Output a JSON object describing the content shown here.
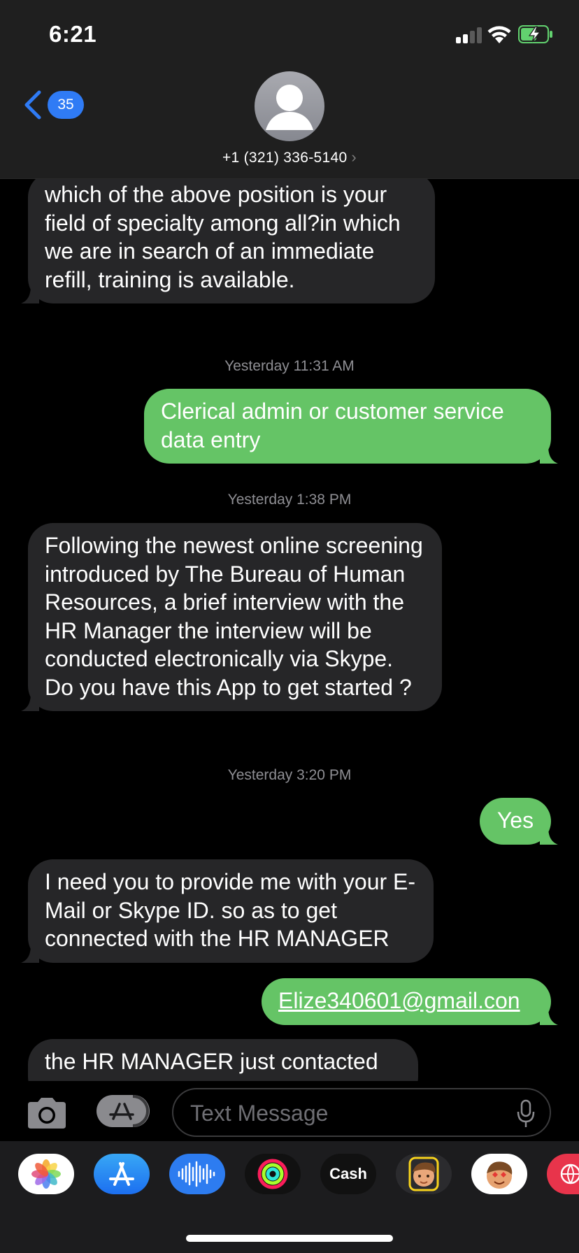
{
  "status_bar": {
    "time": "6:21"
  },
  "header": {
    "back_count": "35",
    "contact": "+1 (321) 336-5140",
    "chevron": "›"
  },
  "messages": [
    {
      "from": "them",
      "text": "which of the above position is your field of specialty among all?in which we are in search of an immediate refill, training is available."
    },
    {
      "timestamp": "Yesterday 11:31 AM"
    },
    {
      "from": "me",
      "text": "Clerical admin or customer service data entry"
    },
    {
      "timestamp": "Yesterday 1:38 PM"
    },
    {
      "from": "them",
      "text": "Following the newest online screening introduced by The Bureau of Human Resources, a brief interview with the HR Manager the interview will be conducted electronically via Skype. Do you have this App   to get started ?"
    },
    {
      "timestamp": "Yesterday 3:20 PM"
    },
    {
      "from": "me",
      "text": "Yes"
    },
    {
      "from": "them",
      "text": "I need you to provide me with your E-Mail or Skype ID. so as to get connected with the HR MANAGER"
    },
    {
      "from": "me",
      "text": "Elize340601@gmail.con",
      "link": true
    },
    {
      "from": "them",
      "text": "the HR MANAGER just contacted"
    }
  ],
  "compose": {
    "placeholder": "Text Message"
  },
  "drawer": {
    "apps": [
      {
        "name": "photos-app-icon"
      },
      {
        "name": "app-store-app-icon"
      },
      {
        "name": "audio-message-app-icon"
      },
      {
        "name": "fitness-app-icon"
      },
      {
        "name": "apple-cash-app-icon",
        "label": "Cash"
      },
      {
        "name": "memoji-app-icon"
      },
      {
        "name": "animoji-app-icon"
      },
      {
        "name": "web-images-app-icon"
      }
    ]
  },
  "colors": {
    "incoming_bubble": "#262628",
    "outgoing_bubble": "#65c466",
    "accent_blue": "#2f7bf5",
    "background": "#000000",
    "timestamp": "#8e8e93"
  }
}
